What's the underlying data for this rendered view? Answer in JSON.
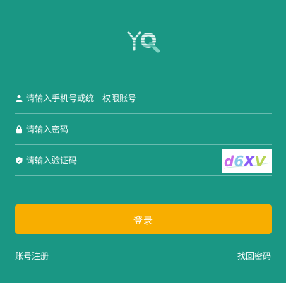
{
  "form": {
    "phone_placeholder": "请输入手机号或统一权限账号",
    "password_placeholder": "请输入密码",
    "code_placeholder": "请输入验证码",
    "captcha_text": "d6XV"
  },
  "actions": {
    "login_label": "登录",
    "register_label": "账号注册",
    "forgot_label": "找回密码"
  },
  "icons": {
    "logo": "yq-logo-icon",
    "phone": "user-icon",
    "password": "lock-icon",
    "code": "shield-icon"
  },
  "colors": {
    "background": "#1a9784",
    "button": "#f8ae00",
    "text": "#ffffff"
  }
}
